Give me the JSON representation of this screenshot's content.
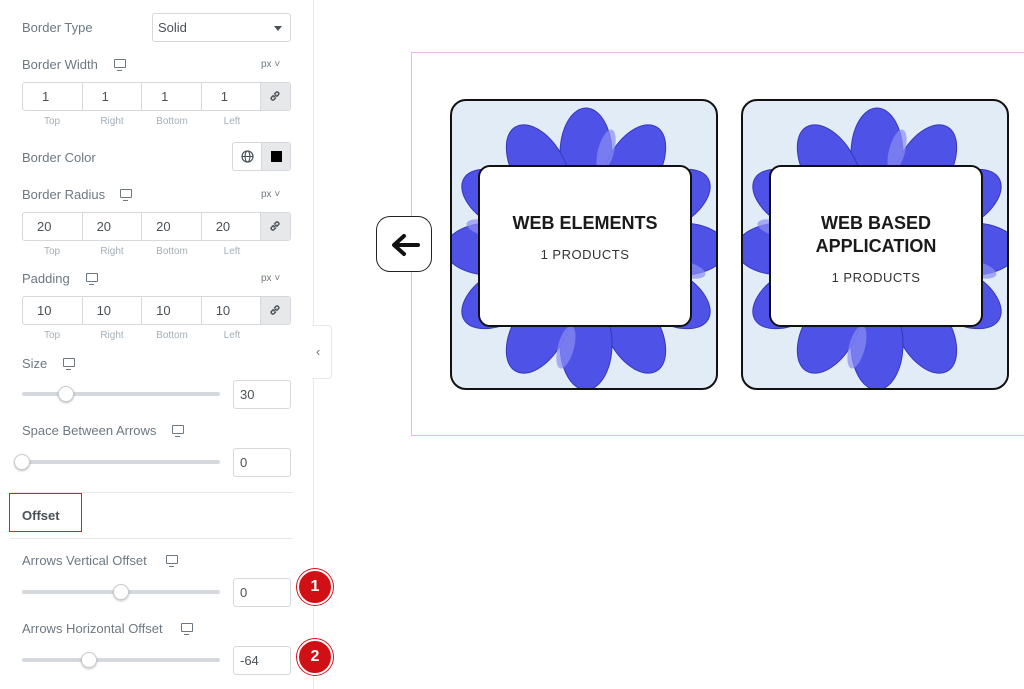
{
  "panel": {
    "border_type": {
      "label": "Border Type",
      "value": "Solid"
    },
    "border_width": {
      "label": "Border Width",
      "unit": "px",
      "values": [
        "1",
        "1",
        "1",
        "1"
      ]
    },
    "dim_labels": {
      "top": "Top",
      "right": "Right",
      "bottom": "Bottom",
      "left": "Left"
    },
    "border_color": {
      "label": "Border Color",
      "value": "#000000"
    },
    "border_radius": {
      "label": "Border Radius",
      "unit": "px",
      "values": [
        "20",
        "20",
        "20",
        "20"
      ]
    },
    "padding": {
      "label": "Padding",
      "unit": "px",
      "values": [
        "10",
        "10",
        "10",
        "10"
      ]
    },
    "size": {
      "label": "Size",
      "value": "30"
    },
    "space_between": {
      "label": "Space Between Arrows",
      "value": "0"
    },
    "offset_section": {
      "label": "Offset"
    },
    "vertical_offset": {
      "label": "Arrows Vertical Offset",
      "value": "0",
      "badge": "1"
    },
    "horizontal_offset": {
      "label": "Arrows Horizontal Offset",
      "value": "-64",
      "badge": "2"
    }
  },
  "preview": {
    "cards": [
      {
        "title": "WEB ELEMENTS",
        "products": "1 PRODUCTS"
      },
      {
        "title": "WEB BASED APPLICATION",
        "products": "1 PRODUCTS"
      }
    ],
    "arrow_icon": "arrow-left-icon"
  },
  "colors": {
    "frame_border": "#e3b6e8",
    "card_bg": "#e1ecf7",
    "flower": "#5b5ef0",
    "badge": "#d11016",
    "highlight_box": "#e21b1b"
  }
}
